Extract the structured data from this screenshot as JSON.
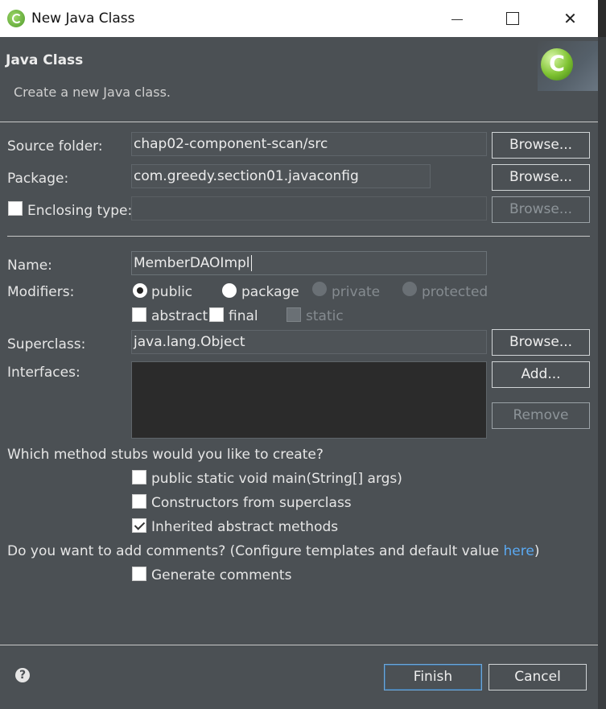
{
  "window": {
    "title": "New Java Class"
  },
  "banner": {
    "title": "Java Class",
    "description": "Create a new Java class.",
    "logo_letter": "C"
  },
  "source_folder": {
    "label": "Source folder:",
    "value": "chap02-component-scan/src",
    "browse": "Browse..."
  },
  "package": {
    "label": "Package:",
    "value": "com.greedy.section01.javaconfig",
    "browse": "Browse..."
  },
  "enclosing_type": {
    "label": "Enclosing type:",
    "value": "",
    "browse": "Browse..."
  },
  "name": {
    "label": "Name:",
    "value": "MemberDAOImpl"
  },
  "modifiers": {
    "label": "Modifiers:",
    "public": "public",
    "package": "package",
    "private": "private",
    "protected": "protected",
    "abstract": "abstract",
    "final": "final",
    "static": "static"
  },
  "superclass": {
    "label": "Superclass:",
    "value": "java.lang.Object",
    "browse": "Browse..."
  },
  "interfaces": {
    "label": "Interfaces:",
    "add": "Add...",
    "remove": "Remove"
  },
  "stubs": {
    "question": "Which method stubs would you like to create?",
    "main": "public static void main(String[] args)",
    "constructors": "Constructors from superclass",
    "inherited": "Inherited abstract methods"
  },
  "comments": {
    "question_prefix": "Do you want to add comments? (Configure templates and default value ",
    "link": "here",
    "question_suffix": ")",
    "generate": "Generate comments"
  },
  "footer": {
    "help": "?",
    "finish": "Finish",
    "cancel": "Cancel"
  }
}
